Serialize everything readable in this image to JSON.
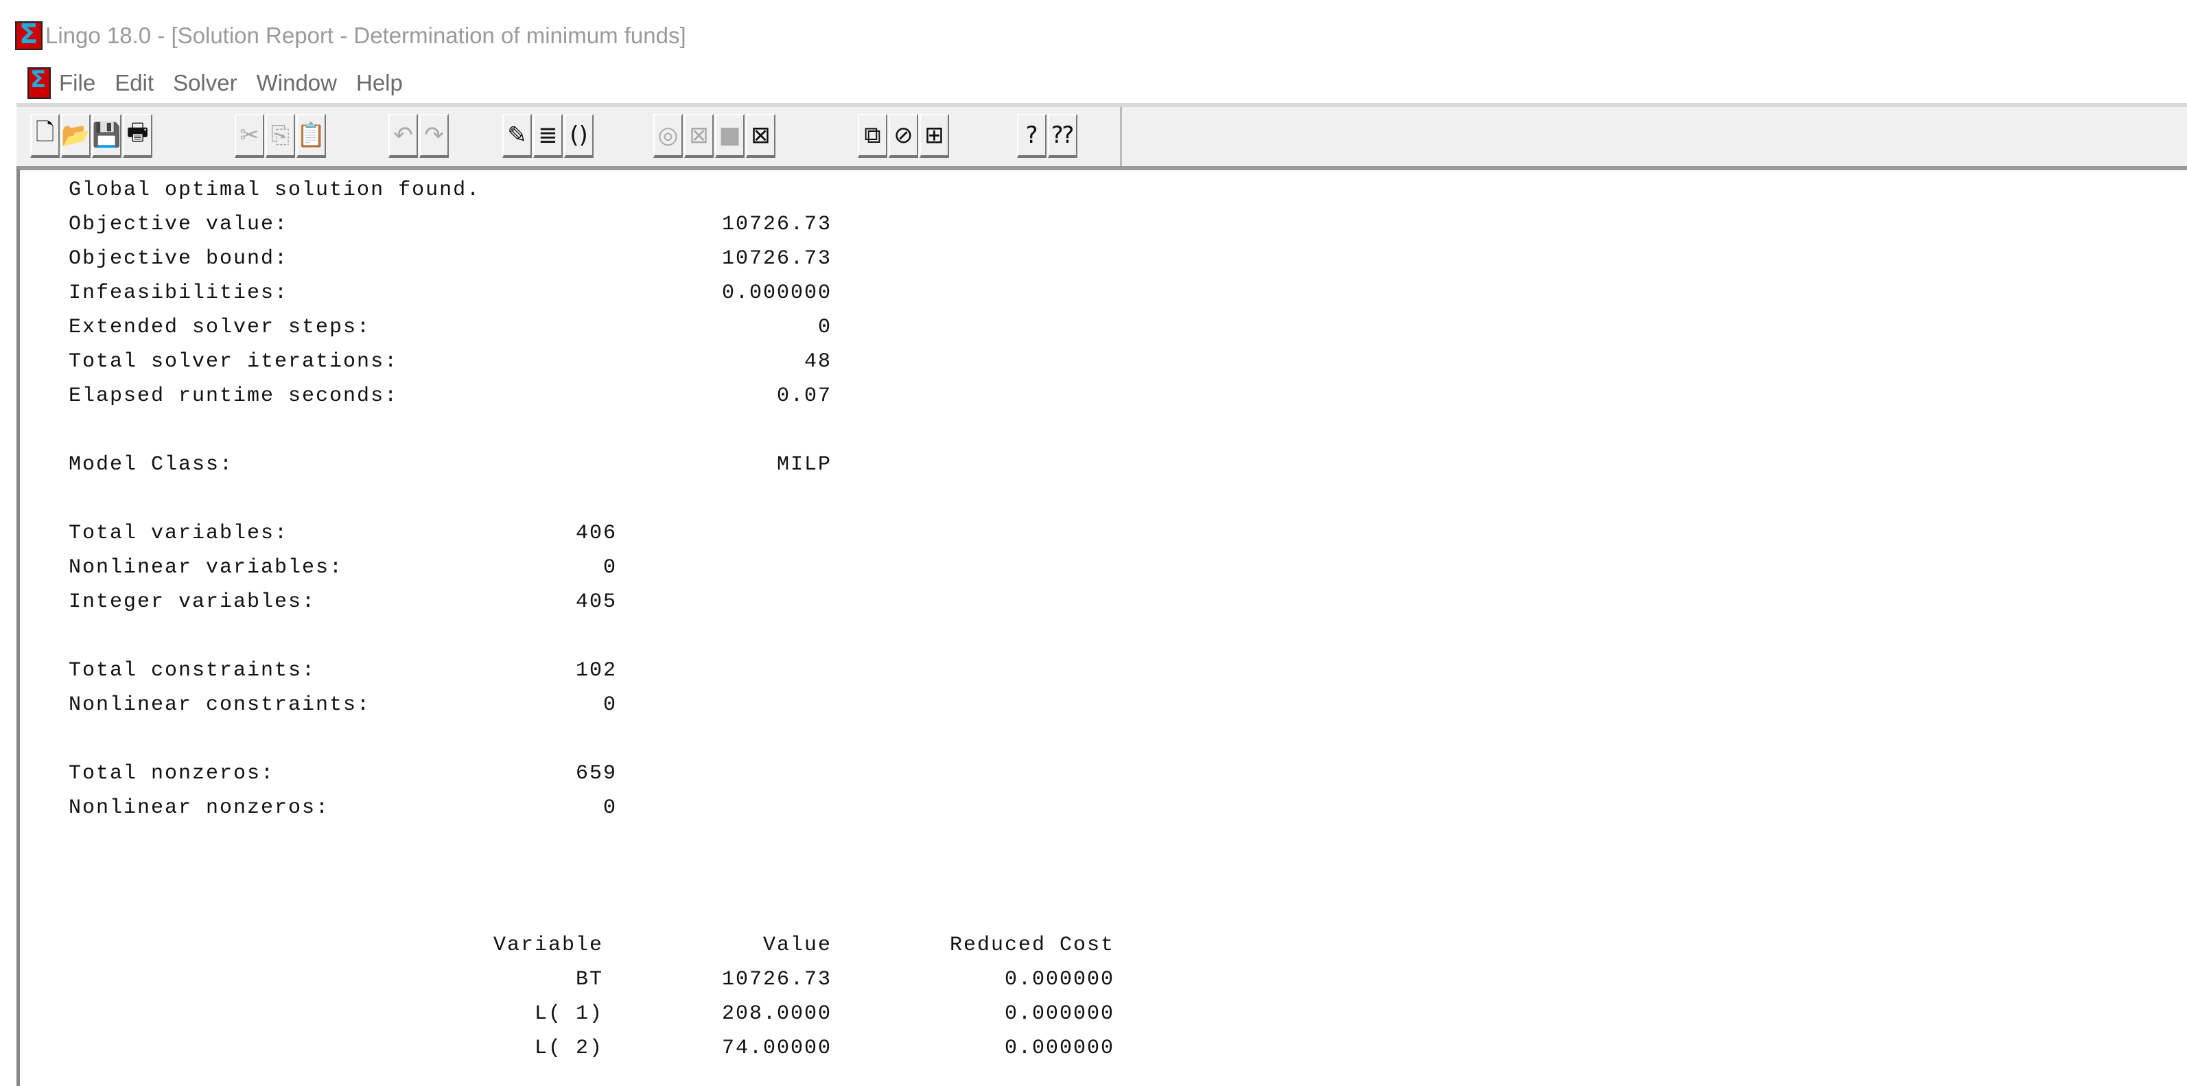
{
  "window": {
    "title": "Lingo 18.0 - [Solution Report - Determination of minimum funds]"
  },
  "menu": [
    "File",
    "Edit",
    "Solver",
    "Window",
    "Help"
  ],
  "toolbar": {
    "groups": [
      [
        {
          "name": "new-icon",
          "glyph": "🗋"
        },
        {
          "name": "open-icon",
          "glyph": "📂"
        },
        {
          "name": "save-icon",
          "glyph": "💾"
        },
        {
          "name": "print-icon",
          "glyph": "🖶"
        }
      ],
      [
        {
          "name": "cut-icon",
          "glyph": "✂",
          "disabled": true
        },
        {
          "name": "copy-icon",
          "glyph": "⎘",
          "disabled": true
        },
        {
          "name": "paste-icon",
          "glyph": "📋"
        }
      ],
      [
        {
          "name": "undo-icon",
          "glyph": "↶",
          "disabled": true
        },
        {
          "name": "redo-icon",
          "glyph": "↷",
          "disabled": true
        }
      ],
      [
        {
          "name": "find-icon",
          "glyph": "✎"
        },
        {
          "name": "go-to-line-icon",
          "glyph": "≣"
        },
        {
          "name": "match-parenthesis-icon",
          "glyph": "()"
        }
      ],
      [
        {
          "name": "solve-icon",
          "glyph": "◎",
          "disabled": true
        },
        {
          "name": "solution-icon",
          "glyph": "⊠",
          "disabled": true
        },
        {
          "name": "stop-icon",
          "glyph": "■",
          "disabled": true
        },
        {
          "name": "close-all-icon",
          "glyph": "⊠"
        }
      ],
      [
        {
          "name": "send-to-back-icon",
          "glyph": "⧉"
        },
        {
          "name": "close-window-icon",
          "glyph": "⊘"
        },
        {
          "name": "tile-icon",
          "glyph": "⊞"
        }
      ],
      [
        {
          "name": "help-icon",
          "glyph": "?"
        },
        {
          "name": "context-help-icon",
          "glyph": "⁇"
        }
      ]
    ]
  },
  "report": {
    "status": "Global optimal solution found.",
    "summary": [
      {
        "label": "Objective value:",
        "value": "10726.73"
      },
      {
        "label": "Objective bound:",
        "value": "10726.73"
      },
      {
        "label": "Infeasibilities:",
        "value": "0.000000"
      },
      {
        "label": "Extended solver steps:",
        "value": "0"
      },
      {
        "label": "Total solver iterations:",
        "value": "48"
      },
      {
        "label": "Elapsed runtime seconds:",
        "value": "0.07"
      }
    ],
    "model_class": {
      "label": "Model Class:",
      "value": "MILP"
    },
    "stats": [
      {
        "label": "Total variables:",
        "value": "406"
      },
      {
        "label": "Nonlinear variables:",
        "value": "0"
      },
      {
        "label": "Integer variables:",
        "value": "405"
      },
      {
        "label": "Total constraints:",
        "value": "102"
      },
      {
        "label": "Nonlinear constraints:",
        "value": "0"
      },
      {
        "label": "Total nonzeros:",
        "value": "659"
      },
      {
        "label": "Nonlinear nonzeros:",
        "value": "0"
      }
    ],
    "table": {
      "headers": [
        "Variable",
        "Value",
        "Reduced Cost"
      ],
      "rows": [
        [
          "BT",
          "10726.73",
          "0.000000"
        ],
        [
          "L( 1)",
          "208.0000",
          "0.000000"
        ],
        [
          "L( 2)",
          "74.00000",
          "0.000000"
        ]
      ]
    }
  }
}
